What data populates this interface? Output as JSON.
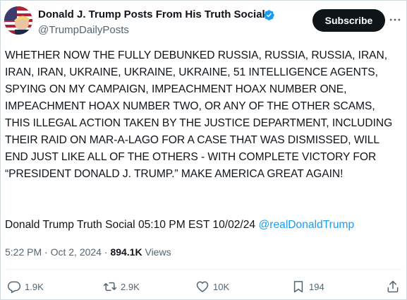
{
  "post": {
    "author_name": "Donald J. Trump Posts From His Truth Social",
    "author_handle": "@TrumpDailyPosts",
    "subscribe_label": "Subscribe",
    "text": "WHETHER NOW THE FULLY DEBUNKED RUSSIA, RUSSIA, RUSSIA, IRAN, IRAN, IRAN, UKRAINE, UKRAINE, UKRAINE, 51 INTELLIGENCE AGENTS, SPYING ON MY CAMPAIGN, IMPEACHMENT HOAX NUMBER ONE, IMPEACHMENT HOAX NUMBER TWO, OR ANY OF THE OTHER SCAMS, THIS ILLEGAL ACTION TAKEN BY THE JUSTICE DEPARTMENT, INCLUDING THEIR RAID ON MAR-A-LAGO FOR A CASE THAT WAS DISMISSED, WILL END JUST LIKE ALL OF THE OTHERS - WITH COMPLETE VICTORY FOR “PRESIDENT DONALD J. TRUMP.” MAKE AMERICA GREAT AGAIN!",
    "signature_text": "Donald Trump Truth Social 05:10 PM EST 10/02/24",
    "signature_mention": "@realDonaldTrump",
    "time": "5:22 PM",
    "separator": "·",
    "date": "Oct 2, 2024",
    "views_count": "894.1K",
    "views_label": "Views"
  },
  "actions": {
    "replies": "1.9K",
    "reposts": "2.9K",
    "likes": "10K",
    "bookmarks": "194"
  },
  "icons": {
    "verified": "verified-badge-icon",
    "more": "more-icon",
    "reply": "reply-icon",
    "repost": "repost-icon",
    "like": "like-icon",
    "bookmark": "bookmark-icon",
    "share": "share-icon"
  },
  "colors": {
    "accent": "#1d9bf0",
    "text": "#0f1419",
    "muted": "#536471",
    "button_bg": "#0f1419"
  }
}
